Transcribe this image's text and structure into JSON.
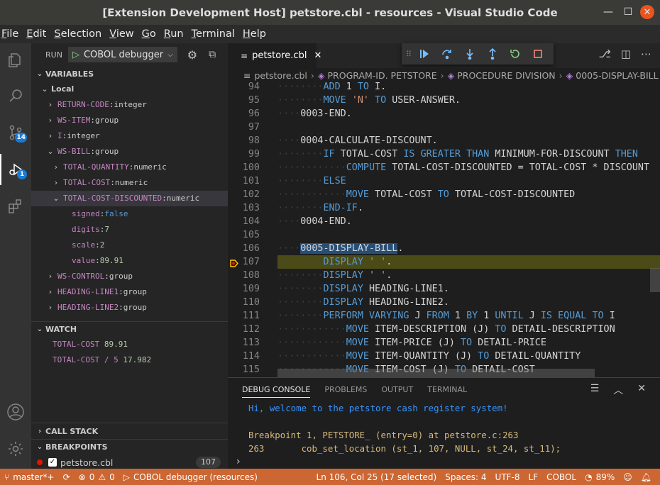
{
  "window": {
    "title": "[Extension Development Host] petstore.cbl - resources - Visual Studio Code"
  },
  "menu": [
    "File",
    "Edit",
    "Selection",
    "View",
    "Go",
    "Run",
    "Terminal",
    "Help"
  ],
  "activity": {
    "scm_badge": "14",
    "debug_badge": "1"
  },
  "run": {
    "label": "RUN",
    "config": "COBOL debugger"
  },
  "variables": {
    "header": "VARIABLES",
    "scope": "Local",
    "items": [
      {
        "name": "RETURN-CODE",
        "type": "integer",
        "indent": 1
      },
      {
        "name": "WS-ITEM",
        "type": "group",
        "indent": 1
      },
      {
        "name": "I",
        "type": "integer",
        "indent": 1
      },
      {
        "name": "WS-BILL",
        "type": "group",
        "indent": 1,
        "open": true
      },
      {
        "name": "TOTAL-QUANTITY",
        "type": "numeric",
        "indent": 2
      },
      {
        "name": "TOTAL-COST",
        "type": "numeric",
        "indent": 2
      },
      {
        "name": "TOTAL-COST-DISCOUNTED",
        "type": "numeric",
        "indent": 2,
        "open": true,
        "selected": true
      },
      {
        "name": "signed",
        "value": "false",
        "indent": 3,
        "leaf": true,
        "kind": "bool"
      },
      {
        "name": "digits",
        "value": "7",
        "indent": 3,
        "leaf": true,
        "kind": "num"
      },
      {
        "name": "scale",
        "value": "2",
        "indent": 3,
        "leaf": true,
        "kind": "num"
      },
      {
        "name": "value",
        "value": "89.91",
        "indent": 3,
        "leaf": true,
        "kind": "num"
      },
      {
        "name": "WS-CONTROL",
        "type": "group",
        "indent": 1
      },
      {
        "name": "HEADING-LINE1",
        "type": "group",
        "indent": 1
      },
      {
        "name": "HEADING-LINE2",
        "type": "group",
        "indent": 1
      }
    ]
  },
  "watch": {
    "header": "WATCH",
    "items": [
      {
        "expr": "TOTAL-COST",
        "value": "89.91"
      },
      {
        "expr": "TOTAL-COST / 5",
        "value": "17.982"
      }
    ]
  },
  "callstack": {
    "header": "CALL STACK"
  },
  "breakpoints": {
    "header": "BREAKPOINTS",
    "items": [
      {
        "file": "petstore.cbl",
        "count": "107"
      }
    ]
  },
  "editor": {
    "tab": "petstore.cbl",
    "breadcrumb": [
      "petstore.cbl",
      "PROGRAM-ID. PETSTORE",
      "PROCEDURE DIVISION",
      "0005-DISPLAY-BILL"
    ],
    "lines": [
      {
        "n": "94",
        "t": "        ADD 1 TO I."
      },
      {
        "n": "95",
        "t": "        MOVE 'N' TO USER-ANSWER."
      },
      {
        "n": "96",
        "t": "    0003-END."
      },
      {
        "n": "97",
        "t": ""
      },
      {
        "n": "98",
        "t": "    0004-CALCULATE-DISCOUNT."
      },
      {
        "n": "99",
        "t": "        IF TOTAL-COST IS GREATER THAN MINIMUM-FOR-DISCOUNT THEN"
      },
      {
        "n": "100",
        "t": "            COMPUTE TOTAL-COST-DISCOUNTED = TOTAL-COST * DISCOUNT"
      },
      {
        "n": "101",
        "t": "        ELSE"
      },
      {
        "n": "102",
        "t": "            MOVE TOTAL-COST TO TOTAL-COST-DISCOUNTED"
      },
      {
        "n": "103",
        "t": "        END-IF."
      },
      {
        "n": "104",
        "t": "    0004-END."
      },
      {
        "n": "105",
        "t": ""
      },
      {
        "n": "106",
        "t": "    0005-DISPLAY-BILL."
      },
      {
        "n": "107",
        "t": "        DISPLAY ' '."
      },
      {
        "n": "108",
        "t": "        DISPLAY ' '."
      },
      {
        "n": "109",
        "t": "        DISPLAY HEADING-LINE1."
      },
      {
        "n": "110",
        "t": "        DISPLAY HEADING-LINE2."
      },
      {
        "n": "111",
        "t": "        PERFORM VARYING J FROM 1 BY 1 UNTIL J IS EQUAL TO I"
      },
      {
        "n": "112",
        "t": "            MOVE ITEM-DESCRIPTION (J) TO DETAIL-DESCRIPTION"
      },
      {
        "n": "113",
        "t": "            MOVE ITEM-PRICE (J) TO DETAIL-PRICE"
      },
      {
        "n": "114",
        "t": "            MOVE ITEM-QUANTITY (J) TO DETAIL-QUANTITY"
      },
      {
        "n": "115",
        "t": "            MOVE ITEM-COST (J) TO DETAIL-COST"
      }
    ],
    "current_line": "107",
    "selected_line": "106"
  },
  "panel": {
    "tabs": [
      "DEBUG CONSOLE",
      "PROBLEMS",
      "OUTPUT",
      "TERMINAL"
    ],
    "output": [
      {
        "text": "Hi, welcome to the petstore cash register system!",
        "color": "#3794ff"
      },
      {
        "text": "",
        "color": "#d4d4d4"
      },
      {
        "text": "Breakpoint 1, PETSTORE_ (entry=0) at petstore.c:263",
        "color": "#d7ba7d"
      },
      {
        "text": "263       cob_set_location (st_1, 107, NULL, st_24, st_11);",
        "color": "#d7ba7d"
      }
    ]
  },
  "status": {
    "branch": "master*+",
    "errors": "0",
    "warnings": "0",
    "debug": "COBOL debugger (resources)",
    "position": "Ln 106, Col 25 (17 selected)",
    "spaces": "Spaces: 4",
    "encoding": "UTF-8",
    "eol": "LF",
    "language": "COBOL",
    "battery": "89%"
  }
}
